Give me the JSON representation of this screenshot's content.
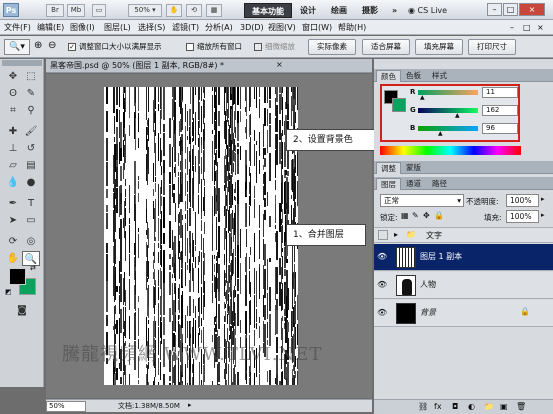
{
  "titlebar": {
    "app_logo": "Ps",
    "btn_br": "Br",
    "btn_mb": "Mb",
    "zoom_select": "50%",
    "workspace_active": "基本功能",
    "workspace_items": [
      "设计",
      "绘画",
      "摄影"
    ],
    "more": "»",
    "cs_live": "CS Live",
    "window_buttons": [
      "–",
      "□",
      "×"
    ]
  },
  "menubar": {
    "items": [
      "文件(F)",
      "编辑(E)",
      "图像(I)",
      "图层(L)",
      "选择(S)",
      "滤镜(T)",
      "分析(A)",
      "3D(D)",
      "视图(V)",
      "窗口(W)",
      "帮助(H)"
    ],
    "doc_controls": [
      "–",
      "□",
      "×"
    ]
  },
  "options": {
    "tool_icon": "zoom-icon",
    "check_resize": "调整窗口大小以满屏显示",
    "check_all_windows": "缩放所有窗口",
    "check_scrubby": "细微缩放",
    "btn_actual": "实际像素",
    "btn_fit": "适合屏幕",
    "btn_fill": "填充屏幕",
    "btn_print": "打印尺寸"
  },
  "document": {
    "title": "黑客帝国.psd @ 50% (图层 1 副本, RGB/8#) *",
    "close": "×",
    "zoom": "50%",
    "info": "文档:1.38M/8.50M",
    "watermark": "騰龍視頻網 WWW.TLVI.NET"
  },
  "callouts": {
    "bg_color": "2、设置背景色",
    "merge_layers": "1、合并图层"
  },
  "color_panel": {
    "tabs": [
      "颜色",
      "色板",
      "样式"
    ],
    "r_label": "R",
    "r_value": "11",
    "g_label": "G",
    "g_value": "162",
    "b_label": "B",
    "b_value": "96",
    "foreground": "#000000",
    "background": "#0ba260"
  },
  "adjust_panel": {
    "tabs": [
      "调整",
      "蒙版"
    ]
  },
  "layers_panel": {
    "tabs": [
      "图层",
      "通道",
      "路径"
    ],
    "blend_mode": "正常",
    "opacity_label": "不透明度:",
    "opacity_value": "100%",
    "lock_label": "锁定:",
    "fill_label": "填充:",
    "fill_value": "100%",
    "layers": [
      {
        "name": "文字",
        "type": "group",
        "visible": false
      },
      {
        "name": "图层 1 副本",
        "type": "layer",
        "visible": true,
        "selected": true
      },
      {
        "name": "人物",
        "type": "layer",
        "visible": true
      },
      {
        "name": "背景",
        "type": "background",
        "visible": true,
        "locked": true
      }
    ]
  },
  "colors": {
    "selected_layer": "#0a246a",
    "highlight_border": "#d0221b"
  }
}
